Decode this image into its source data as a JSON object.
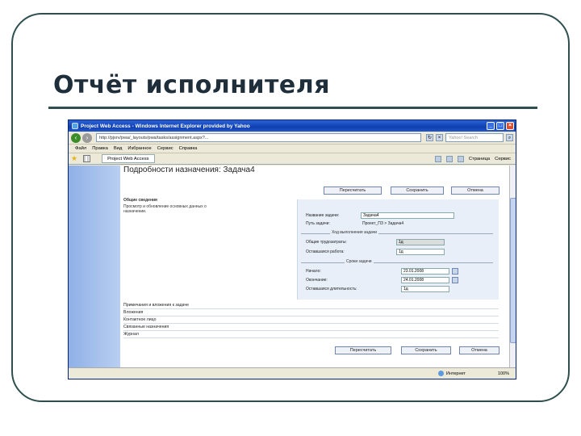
{
  "slide": {
    "title": "Отчёт исполнителя"
  },
  "browser": {
    "window_title": "Project Web Access - Windows Internet Explorer provided by Yahoo",
    "address_url": "http://pjsrv/pwa/_layouts/pwa/tasks/assignment.aspx?...",
    "search_placeholder": "Yahoo! Search",
    "menu": [
      "Файл",
      "Правка",
      "Вид",
      "Избранное",
      "Сервис",
      "Справка"
    ],
    "tab_label": "Project Web Access",
    "toolbar": {
      "page_label": "Страница",
      "tools_label": "Сервис"
    },
    "status": {
      "zone": "Интернет",
      "zoom": "100%"
    }
  },
  "page": {
    "heading": "Подробности назначения: Задача4",
    "buttons_top": [
      "Пересчитать",
      "Сохранить",
      "Отмена"
    ],
    "buttons_bottom": [
      "Пересчитать",
      "Сохранить",
      "Отмена"
    ],
    "general": {
      "section_title": "Общие сведения",
      "description": "Просмотр и обновление основных данных о назначении."
    },
    "form": {
      "task_name_label": "Название задачи:",
      "task_name_value": "Задача4",
      "task_path_label": "Путь задачи:",
      "task_path_value": "Проект_ПЗ > Задача4",
      "work_group_title": "Ход выполнения задачи",
      "total_work_label": "Общие трудозатраты:",
      "total_work_value": "1д",
      "remaining_work_label": "Оставшаяся работа:",
      "remaining_work_value": "1д",
      "dates_group_title": "Сроки задачи",
      "start_label": "Начало:",
      "start_value": "23.01.2008",
      "finish_label": "Окончание:",
      "finish_value": "24.01.2008",
      "remaining_dur_label": "Оставшаяся длительность:",
      "remaining_dur_value": "1д"
    },
    "sections": [
      "Примечания и вложения к задаче",
      "Вложения",
      "Контактное лицо",
      "Связанные назначения",
      "Журнал"
    ]
  }
}
